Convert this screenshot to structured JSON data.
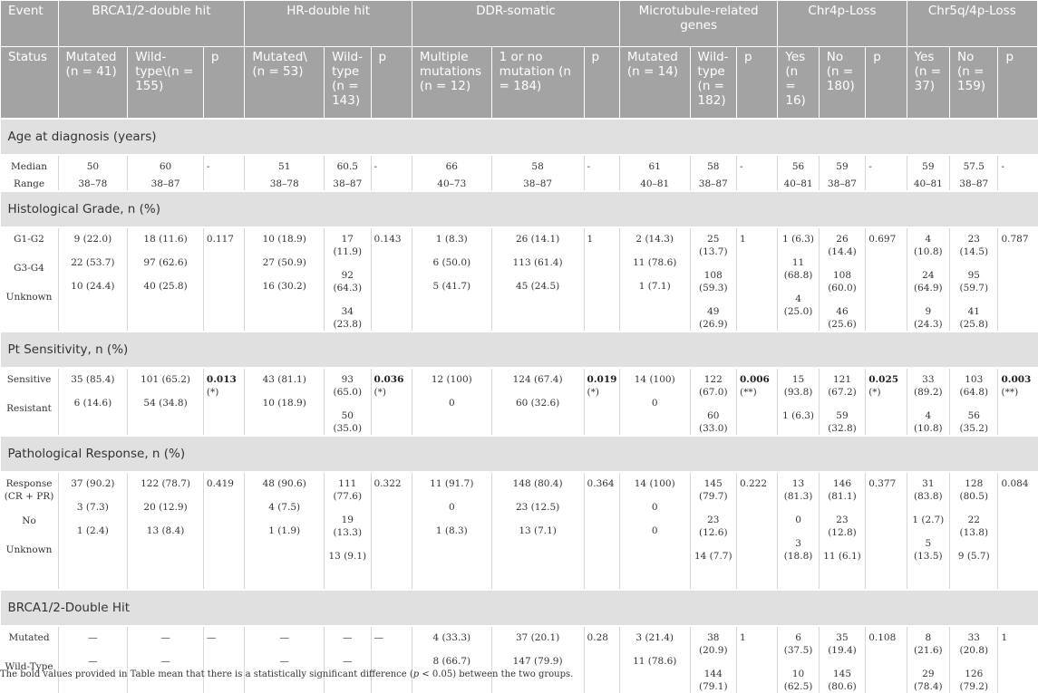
{
  "header": {
    "event_label": "Event",
    "status_label": "Status",
    "groups": [
      {
        "name": "BRCA1/2-double hit",
        "cols": [
          [
            "Mutated",
            "(n = 41)"
          ],
          [
            "Wild-type\\(n = 155)"
          ]
        ]
      },
      {
        "name": "HR-double hit",
        "cols": [
          [
            "Mutated\\(n = 53)"
          ],
          [
            "Wild-type",
            "(n = 143)"
          ]
        ]
      },
      {
        "name": "DDR-somatic",
        "cols": [
          [
            "Multiple mutations (n = 12)"
          ],
          [
            "1 or no mutation (n = 184)"
          ]
        ]
      },
      {
        "name": "Microtubule-related genes",
        "cols": [
          [
            "Mutated (n = 14)"
          ],
          [
            "Wild-type",
            "(n = 182)"
          ]
        ]
      },
      {
        "name": "Chr4p-Loss",
        "cols": [
          [
            "Yes",
            "(n = 16)"
          ],
          [
            "No",
            "(n = 180)"
          ]
        ]
      },
      {
        "name": "Chr5q/4p-Loss",
        "cols": [
          [
            "Yes",
            "(n = 37)"
          ],
          [
            "No",
            "(n = 159)"
          ]
        ]
      }
    ],
    "p_label": "p"
  },
  "sections": {
    "age": "Age at diagnosis (years)",
    "grade": "Histological Grade, n (%)",
    "pt": "Pt Sensitivity, n (%)",
    "path": "Pathological Response, n (%)",
    "brca": "BRCA1/2-Double Hit"
  },
  "labels": {
    "age": [
      "Median",
      "Range"
    ],
    "grade": [
      "G1-G2",
      "G3-G4",
      "Unknown"
    ],
    "pt": [
      "Sensitive",
      "Resistant"
    ],
    "path": [
      "Response (CR + PR)",
      "No",
      "Unknown"
    ],
    "brca": [
      "Mutated",
      "Wild-Type"
    ]
  },
  "cells": {
    "age": [
      [
        [
          "50",
          "38–78"
        ],
        [
          "60",
          "38–87"
        ],
        "-",
        [
          "51",
          "38–78"
        ],
        [
          "60.5",
          "38–87"
        ],
        "-",
        [
          "66",
          "40–73"
        ],
        [
          "58",
          "38–87"
        ],
        "-",
        [
          "61",
          "40–81"
        ],
        [
          "58",
          "38–87"
        ],
        "-",
        [
          "56",
          "40–81"
        ],
        [
          "59",
          "38–87"
        ],
        "-",
        [
          "59",
          "40–81"
        ],
        [
          "57.5",
          "38–87"
        ],
        "-"
      ]
    ],
    "grade": [
      [
        [
          "9 (22.0)",
          "22 (53.7)",
          "10 (24.4)"
        ],
        [
          "18 (11.6)",
          "97 (62.6)",
          "40 (25.8)"
        ],
        "0.117",
        [
          "10 (18.9)",
          "27 (50.9)",
          "16 (30.2)"
        ],
        [
          "17 (11.9)",
          "92 (64.3)",
          "34 (23.8)"
        ],
        "0.143",
        [
          "1 (8.3)",
          "6 (50.0)",
          "5 (41.7)"
        ],
        [
          "26 (14.1)",
          "113 (61.4)",
          "45 (24.5)"
        ],
        "1",
        [
          "2 (14.3)",
          "11 (78.6)",
          "1 (7.1)"
        ],
        [
          "25 (13.7)",
          "108 (59.3)",
          "49 (26.9)"
        ],
        "1",
        [
          "1 (6.3)",
          "11 (68.8)",
          "4 (25.0)"
        ],
        [
          "26 (14.4)",
          "108 (60.0)",
          "46 (25.6)"
        ],
        "0.697",
        [
          "4 (10.8)",
          "24 (64.9)",
          "9 (24.3)"
        ],
        [
          "23 (14.5)",
          "95 (59.7)",
          "41 (25.8)"
        ],
        "0.787"
      ]
    ],
    "pt": [
      [
        [
          "35 (85.4)",
          "6 (14.6)"
        ],
        [
          "101 (65.2)",
          "54 (34.8)"
        ],
        [
          "0.013",
          "(*)"
        ],
        [
          "43 (81.1)",
          "10 (18.9)"
        ],
        [
          "93 (65.0)",
          "50 (35.0)"
        ],
        [
          "0.036",
          "(*)"
        ],
        [
          "12 (100)",
          "0"
        ],
        [
          "124 (67.4)",
          "60 (32.6)"
        ],
        [
          "0.019",
          "(*)"
        ],
        [
          "14 (100)",
          "0"
        ],
        [
          "122 (67.0)",
          "60 (33.0)"
        ],
        [
          "0.006",
          "(**)"
        ],
        [
          "15 (93.8)",
          "1 (6.3)"
        ],
        [
          "121 (67.2)",
          "59 (32.8)"
        ],
        [
          "0.025",
          "(*)"
        ],
        [
          "33 (89.2)",
          "4 (10.8)"
        ],
        [
          "103 (64.8)",
          "56 (35.2)"
        ],
        [
          "0.003",
          "(**)"
        ]
      ]
    ],
    "path": [
      [
        [
          "37 (90.2)",
          "3 (7.3)",
          "1 (2.4)"
        ],
        [
          "122 (78.7)",
          "20 (12.9)",
          "13 (8.4)"
        ],
        "0.419",
        [
          "48 (90.6)",
          "4 (7.5)",
          "1 (1.9)"
        ],
        [
          "111 (77.6)",
          "19 (13.3)",
          "13 (9.1)"
        ],
        "0.322",
        [
          "11 (91.7)",
          "0",
          "1 (8.3)"
        ],
        [
          "148 (80.4)",
          "23 (12.5)",
          "13 (7.1)"
        ],
        "0.364",
        [
          "14 (100)",
          "0",
          "0"
        ],
        [
          "145 (79.7)",
          "23 (12.6)",
          "14 (7.7)"
        ],
        "0.222",
        [
          "13 (81.3)",
          "0",
          "3 (18.8)"
        ],
        [
          "146 (81.1)",
          "23 (12.8)",
          "11 (6.1)"
        ],
        "0.377",
        [
          "31 (83.8)",
          "1 (2.7)",
          "5 (13.5)"
        ],
        [
          "128 (80.5)",
          "22 (13.8)",
          "9 (5.7)"
        ],
        "0.084"
      ]
    ],
    "brca": [
      [
        [
          "—",
          "—"
        ],
        [
          "—",
          "—"
        ],
        "—",
        [
          "—",
          "—"
        ],
        [
          "—",
          "—"
        ],
        "—",
        [
          "4 (33.3)",
          "8 (66.7)"
        ],
        [
          "37 (20.1)",
          "147 (79.9)"
        ],
        "0.28",
        [
          "3 (21.4)",
          "11 (78.6)"
        ],
        [
          "38 (20.9)",
          "144 (79.1)"
        ],
        "1",
        [
          "6 (37.5)",
          "10 (62.5)"
        ],
        [
          "35 (19.4)",
          "145 (80.6)"
        ],
        "0.108",
        [
          "8 (21.6)",
          "29 (78.4)"
        ],
        [
          "33 (20.8)",
          "126 (79.2)"
        ],
        "1"
      ]
    ]
  },
  "footnote": {
    "before": "The bold values provided in Table mean that there is a statistically significant difference (",
    "p": "p",
    "after": " < 0.05) between the two groups."
  }
}
